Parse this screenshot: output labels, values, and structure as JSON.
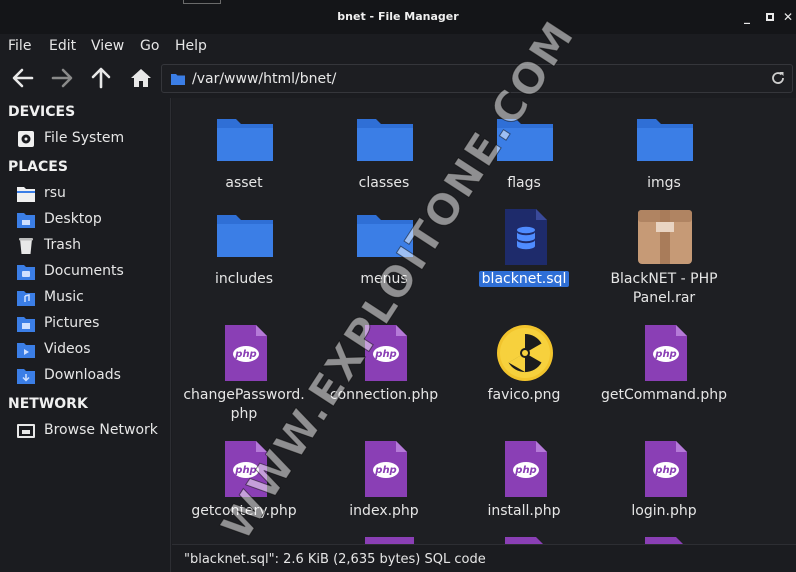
{
  "window": {
    "title": "bnet - File Manager",
    "min_label": "_",
    "close_label": "✕"
  },
  "menu": [
    "File",
    "Edit",
    "View",
    "Go",
    "Help"
  ],
  "address": {
    "path": "/var/www/html/bnet/"
  },
  "sidebar": {
    "devices_heading": "DEVICES",
    "places_heading": "PLACES",
    "network_heading": "NETWORK",
    "devices": [
      {
        "label": "File System",
        "icon": "drive-icon"
      }
    ],
    "places": [
      {
        "label": "rsu",
        "icon": "home-folder-icon"
      },
      {
        "label": "Desktop",
        "icon": "desktop-icon"
      },
      {
        "label": "Trash",
        "icon": "trash-icon"
      },
      {
        "label": "Documents",
        "icon": "documents-folder-icon"
      },
      {
        "label": "Music",
        "icon": "music-folder-icon"
      },
      {
        "label": "Pictures",
        "icon": "pictures-folder-icon"
      },
      {
        "label": "Videos",
        "icon": "videos-folder-icon"
      },
      {
        "label": "Downloads",
        "icon": "downloads-folder-icon"
      }
    ],
    "network": [
      {
        "label": "Browse Network",
        "icon": "network-icon"
      }
    ]
  },
  "files": [
    {
      "name": "asset",
      "type": "folder"
    },
    {
      "name": "classes",
      "type": "folder"
    },
    {
      "name": "flags",
      "type": "folder"
    },
    {
      "name": "imgs",
      "type": "folder"
    },
    {
      "name": "includes",
      "type": "folder"
    },
    {
      "name": "menus",
      "type": "folder"
    },
    {
      "name": "blacknet.sql",
      "type": "sql",
      "selected": true
    },
    {
      "name": "BlackNET - PHP Panel.rar",
      "type": "archive"
    },
    {
      "name": "changePassword.php",
      "type": "php"
    },
    {
      "name": "connection.php",
      "type": "php"
    },
    {
      "name": "favico.png",
      "type": "image"
    },
    {
      "name": "getCommand.php",
      "type": "php"
    },
    {
      "name": "getcontery.php",
      "type": "php"
    },
    {
      "name": "index.php",
      "type": "php"
    },
    {
      "name": "install.php",
      "type": "php"
    },
    {
      "name": "login.php",
      "type": "php"
    }
  ],
  "watermark": "WWW.EXPLOITONE.COM",
  "status": "\"blacknet.sql\": 2.6 KiB (2,635 bytes) SQL code",
  "colors": {
    "folder": "#3b7ee6",
    "php": "#8a3fb5",
    "selection": "#2f6fd6",
    "sql": "#1e2b6b"
  }
}
